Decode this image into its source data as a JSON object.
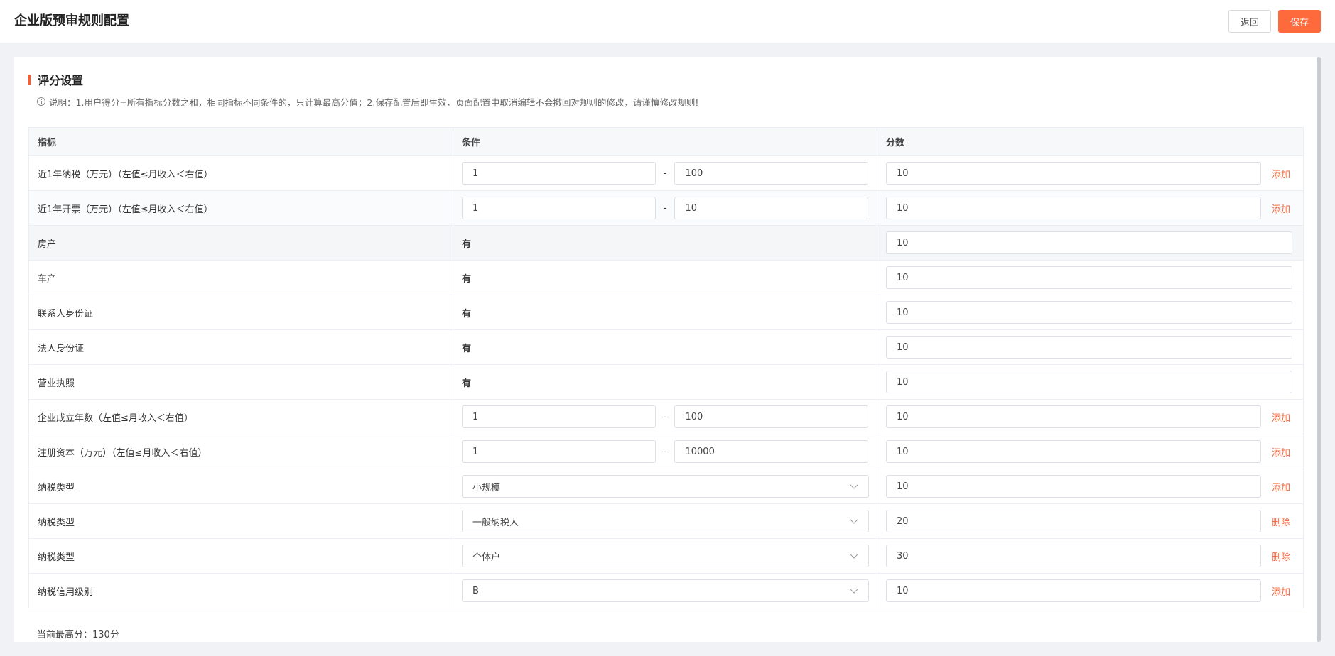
{
  "header": {
    "title": "企业版预审规则配置",
    "back_label": "返回",
    "save_label": "保存",
    "accent_color": "#ff6a3c"
  },
  "section": {
    "title": "评分设置",
    "note_icon": "info-icon",
    "note": "说明：1.用户得分=所有指标分数之和，相同指标不同条件的，只计算最高分值；2.保存配置后即生效，页面配置中取消编辑不会撤回对规则的修改，请谨慎修改规则!"
  },
  "table": {
    "columns": [
      "指标",
      "条件",
      "分数"
    ],
    "rows": [
      {
        "indicator": "近1年纳税（万元）（左值≤月收入＜右值）",
        "type": "range",
        "min": "1",
        "max": "100",
        "dash": "-",
        "score": "10",
        "action": "添加"
      },
      {
        "indicator": "近1年开票（万元）（左值≤月收入＜右值）",
        "type": "range",
        "min": "1",
        "max": "10",
        "dash": "-",
        "score": "10",
        "action": "添加"
      },
      {
        "indicator": "房产",
        "type": "text",
        "condition": "有",
        "score": "10"
      },
      {
        "indicator": "车产",
        "type": "text",
        "condition": "有",
        "score": "10"
      },
      {
        "indicator": "联系人身份证",
        "type": "text",
        "condition": "有",
        "score": "10"
      },
      {
        "indicator": "法人身份证",
        "type": "text",
        "condition": "有",
        "score": "10"
      },
      {
        "indicator": "营业执照",
        "type": "text",
        "condition": "有",
        "score": "10"
      },
      {
        "indicator": "企业成立年数（左值≤月收入＜右值）",
        "type": "range",
        "min": "1",
        "max": "100",
        "dash": "-",
        "score": "10",
        "action": "添加"
      },
      {
        "indicator": "注册资本（万元）（左值≤月收入＜右值）",
        "type": "range",
        "min": "1",
        "max": "10000",
        "dash": "-",
        "score": "10",
        "action": "添加"
      },
      {
        "indicator": "纳税类型",
        "type": "select",
        "selected": "小规模",
        "score": "10",
        "action": "添加"
      },
      {
        "indicator": "纳税类型",
        "type": "select",
        "selected": "一般纳税人",
        "score": "20",
        "action": "删除"
      },
      {
        "indicator": "纳税类型",
        "type": "select",
        "selected": "个体户",
        "score": "30",
        "action": "删除"
      },
      {
        "indicator": "纳税信用级别",
        "type": "select",
        "selected": "B",
        "score": "10",
        "action": "添加"
      }
    ]
  },
  "footer": {
    "max_score": "当前最高分：130分"
  }
}
